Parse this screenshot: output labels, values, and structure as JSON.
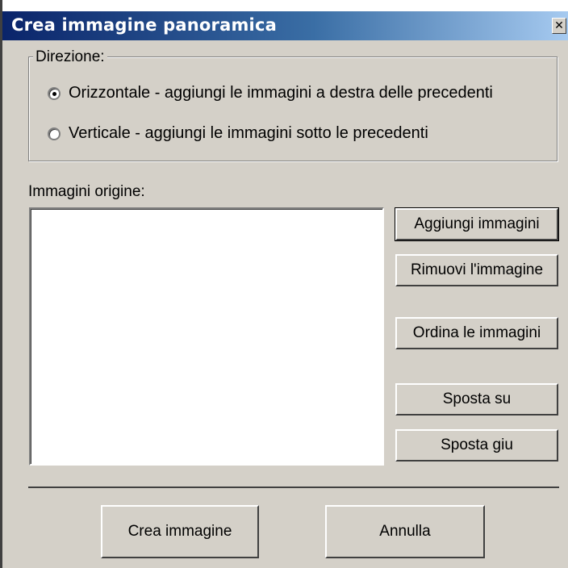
{
  "dialog": {
    "title": "Crea immagine panoramica",
    "close_glyph": "✕"
  },
  "direction": {
    "label": "Direzione:",
    "options": [
      {
        "label": "Orizzontale - aggiungi le immagini a destra delle precedenti",
        "checked": true
      },
      {
        "label": "Verticale - aggiungi le immagini sotto le precedenti",
        "checked": false
      }
    ]
  },
  "sources": {
    "label": "Immagini origine:",
    "items": []
  },
  "side_buttons": {
    "add": "Aggiungi immagini",
    "remove": "Rimuovi l'immagine",
    "sort": "Ordina le immagini",
    "move_up": "Sposta su",
    "move_down": "Sposta giu"
  },
  "footer": {
    "create": "Crea immagine",
    "cancel": "Annulla"
  }
}
